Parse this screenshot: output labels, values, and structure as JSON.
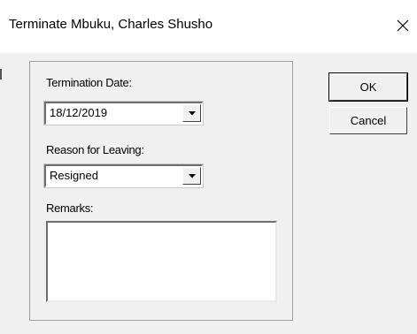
{
  "window": {
    "title": "Terminate Mbuku, Charles Shusho"
  },
  "icons": {
    "close": "close-icon",
    "dropdown": "chevron-down-icon"
  },
  "form": {
    "termination_date_label": "Termination Date:",
    "termination_date_value": "18/12/2019",
    "reason_label": "Reason for Leaving:",
    "reason_value": "Resigned",
    "remarks_label": "Remarks:",
    "remarks_value": ""
  },
  "buttons": {
    "ok_label": "OK",
    "cancel_label": "Cancel"
  },
  "colors": {
    "dialog_background": "#f0f0f0",
    "titlebar_background": "#ffffff"
  }
}
